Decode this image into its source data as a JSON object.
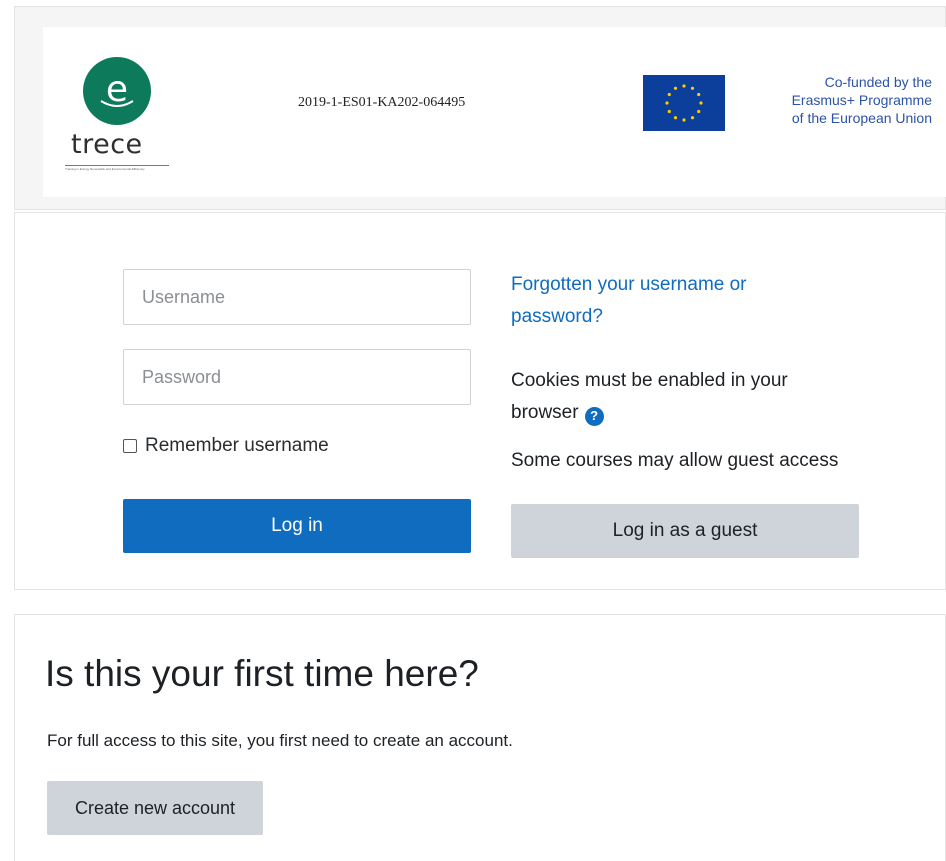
{
  "header": {
    "logo_letter": "e",
    "logo_word": "trece",
    "logo_tagline": "Training in Energy Renewable and Environmental Efficiency",
    "project_code": "2019-1-ES01-KA202-064495",
    "funding_line1": "Co-funded by the",
    "funding_line2": "Erasmus+ Programme",
    "funding_line3": "of the European Union"
  },
  "login": {
    "username_placeholder": "Username",
    "password_placeholder": "Password",
    "remember_label": "Remember username",
    "remember_checked": false,
    "login_button": "Log in",
    "forgot_link": "Forgotten your username or password?",
    "cookies_note": "Cookies must be enabled in your browser",
    "guest_note": "Some courses may allow guest access",
    "guest_button": "Log in as a guest"
  },
  "signup": {
    "title": "Is this your first time here?",
    "description": "For full access to this site, you first need to create an account.",
    "create_button": "Create new account"
  },
  "colors": {
    "primary": "#0f6cbf",
    "secondary_button": "#ced4da",
    "logo_green": "#0e7a5c",
    "eu_blue": "#0c3f9c",
    "eu_star": "#ffcc00"
  },
  "icons": {
    "help": "question-circle-icon",
    "eu_stars": "eu-stars-icon"
  }
}
